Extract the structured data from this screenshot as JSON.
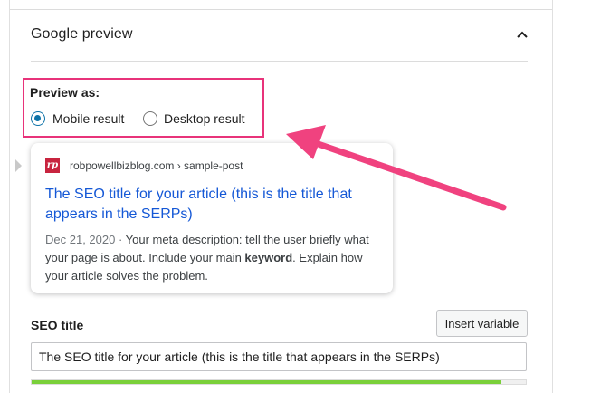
{
  "section": {
    "title": "Google preview"
  },
  "preview_as": {
    "label": "Preview as:",
    "options": [
      {
        "label": "Mobile result",
        "checked": true
      },
      {
        "label": "Desktop result",
        "checked": false
      }
    ]
  },
  "serp": {
    "favicon_text": "rp",
    "url": "robpowellbizblog.com › sample-post",
    "title": "The SEO title for your article (this is the title that appears in the SERPs)",
    "date": "Dec 21, 2020",
    "separator": " · ",
    "description_before": "Your meta description: tell the user briefly what your page is about. Include your main ",
    "keyword": "keyword",
    "description_after": ". Explain how your article solves the problem."
  },
  "seo_title": {
    "label": "SEO title",
    "insert_button": "Insert variable",
    "value": "The SEO title for your article (this is the title that appears in the SERPs)",
    "progress": 0.95
  },
  "colors": {
    "highlight": "#e8337a",
    "radio_accent": "#0e73a8",
    "link": "#1558d6",
    "progress": "#7ad03a",
    "arrow": "#f0427f"
  },
  "icons": {
    "collapse": "chevron-up-icon",
    "favicon": "site-favicon-icon"
  }
}
